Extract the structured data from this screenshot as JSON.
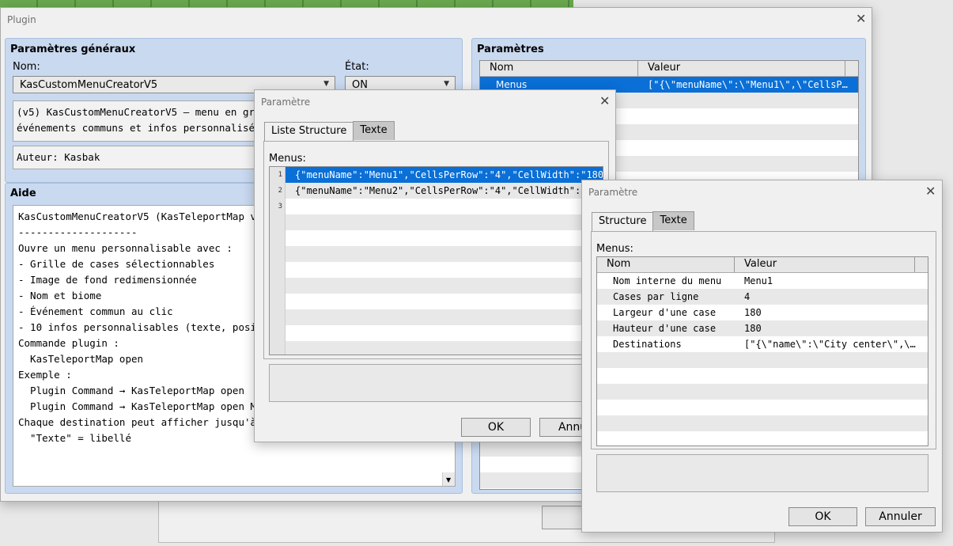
{
  "main": {
    "title": "Plugin",
    "general": {
      "title": "Paramètres généraux",
      "name_label": "Nom:",
      "name_value": "KasCustomMenuCreatorV5",
      "state_label": "État:",
      "state_value": "ON",
      "description": [
        "(v5) KasCustomMenuCreatorV5 – menu en grille",
        "événements communs et infos personnalisées."
      ],
      "author": "Auteur: Kasbak"
    },
    "help": {
      "title": "Aide",
      "lines": [
        "KasCustomMenuCreatorV5 (KasTeleportMap v5)",
        "--------------------",
        "Ouvre un menu personnalisable avec :",
        "- Grille de cases sélectionnables",
        "- Image de fond redimensionnée",
        "- Nom et biome",
        "- Événement commun au clic",
        "- 10 infos personnalisables (texte, position",
        "",
        "Commande plugin :",
        "  KasTeleportMap open",
        "",
        "Exemple :",
        "  Plugin Command → KasTeleportMap open",
        "  Plugin Command → KasTeleportMap open Menu",
        "",
        "Chaque destination peut afficher jusqu'à 10 infos :",
        "  \"Texte\" = libellé"
      ]
    },
    "params": {
      "title": "Paramètres",
      "col_name": "Nom",
      "col_value": "Valeur",
      "rows": [
        {
          "name": "Menus",
          "value": "[\"{\\\"menuName\\\":\\\"Menu1\\\",\\\"CellsP…"
        }
      ]
    }
  },
  "dialog1": {
    "title": "Paramètre",
    "tab_structure": "Liste Structure",
    "tab_text": "Texte",
    "list_label": "Menus:",
    "lines": [
      {
        "num": "1",
        "text": "{\"menuName\":\"Menu1\",\"CellsPerRow\":\"4\",\"CellWidth\":\"180…"
      },
      {
        "num": "2",
        "text": "{\"menuName\":\"Menu2\",\"CellsPerRow\":\"4\",\"CellWidth\":\"18"
      },
      {
        "num": "3",
        "text": ""
      }
    ],
    "ok": "OK",
    "cancel": "Annul"
  },
  "dialog2": {
    "title": "Paramètre",
    "tab_structure": "Structure",
    "tab_text": "Texte",
    "list_label": "Menus:",
    "col_name": "Nom",
    "col_value": "Valeur",
    "rows": [
      {
        "name": "Nom interne du menu",
        "value": "Menu1"
      },
      {
        "name": "Cases par ligne",
        "value": "4"
      },
      {
        "name": "Largeur d'une case",
        "value": "180"
      },
      {
        "name": "Hauteur d'une case",
        "value": "180"
      },
      {
        "name": "Destinations",
        "value": "[\"{\\\"name\\\":\\\"City center\\\",\\…"
      }
    ],
    "ok": "OK",
    "cancel": "Annuler"
  }
}
